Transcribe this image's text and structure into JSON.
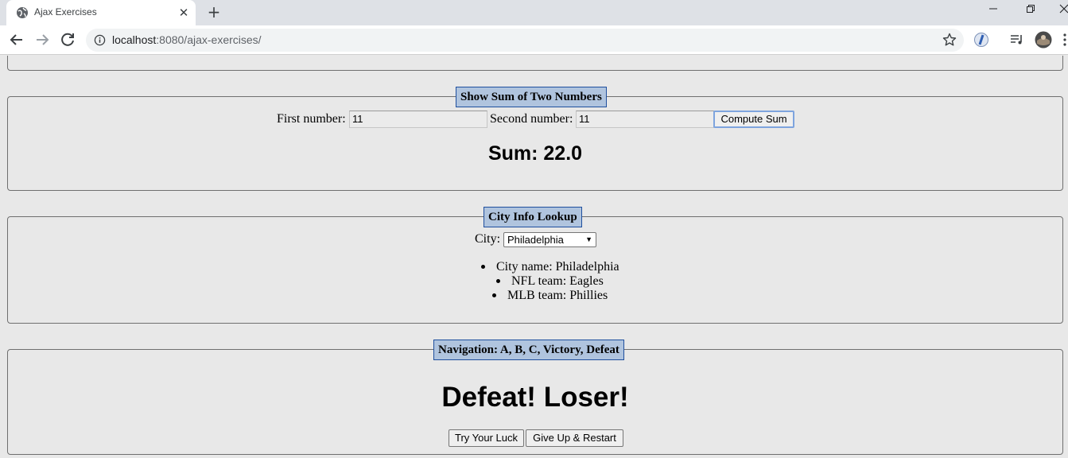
{
  "browser": {
    "tab_title": "Ajax Exercises",
    "tab_close": "✕",
    "new_tab": "+",
    "url_host": "localhost",
    "url_path": ":8080/ajax-exercises/"
  },
  "sum_section": {
    "legend": "Show Sum of Two Numbers",
    "first_label": "First number:",
    "first_value": "11",
    "second_label": "Second number:",
    "second_value": "11",
    "button_label": "Compute Sum",
    "result": "Sum: 22.0"
  },
  "city_section": {
    "legend": "City Info Lookup",
    "city_label": "City:",
    "selected_city": "Philadelphia",
    "info": [
      "City name: Philadelphia",
      "NFL team: Eagles",
      "MLB team: Phillies"
    ]
  },
  "nav_section": {
    "legend": "Navigation: A, B, C, Victory, Defeat",
    "message": "Defeat! Loser!",
    "try_button": "Try Your Luck",
    "restart_button": "Give Up & Restart"
  },
  "colors": {
    "legend_bg": "#b0c4de",
    "legend_border": "#1f4f9e",
    "page_bg": "#e8e8e8"
  }
}
